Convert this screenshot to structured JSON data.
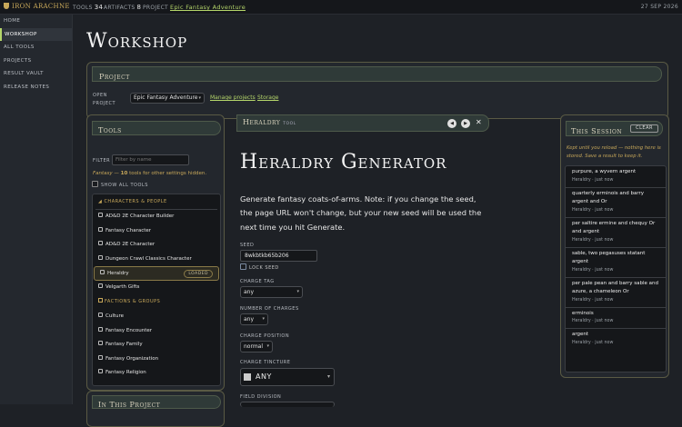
{
  "topbar": {
    "brand": "IRON ARACHNE",
    "tools_label": "TOOLS",
    "tools_count": "34",
    "artifacts_label": "ARTIFACTS",
    "artifacts_count": "8",
    "project_label": "PROJECT",
    "project_name": "Epic Fantasy Adventure",
    "date": "27 SEP 2026"
  },
  "sidebar": {
    "items": [
      {
        "label": "HOME"
      },
      {
        "label": "WORKSHOP"
      },
      {
        "label": "ALL TOOLS"
      },
      {
        "label": "PROJECTS"
      },
      {
        "label": "RESULT VAULT"
      },
      {
        "label": "RELEASE NOTES"
      }
    ],
    "active_index": 1
  },
  "page_title": "Workshop",
  "project_panel": {
    "title": "Project",
    "open_label_1": "OPEN",
    "open_label_2": "PROJECT",
    "selected": "Epic Fantasy Adventure",
    "manage_link": "Manage projects",
    "storage_link": "Storage"
  },
  "tools_panel": {
    "title": "Tools",
    "filter_label": "FILTER",
    "filter_placeholder": "Filter by name",
    "hint_genre": "Fantasy",
    "hint_count": "10",
    "hint_rest": "tools for other settings hidden.",
    "show_all_label": "SHOW ALL TOOLS",
    "groups": [
      {
        "label": "CHARACTERS & PEOPLE",
        "items": [
          "AD&D 2E Character Builder",
          "Fantasy Character",
          "AD&D 2E Character",
          "Dungeon Crawl Classics Character",
          "Heraldry",
          "Velgarth Gifts"
        ]
      },
      {
        "label": "FACTIONS & GROUPS",
        "items": [
          "Culture",
          "Fantasy Encounter",
          "Fantasy Family",
          "Fantasy Organization",
          "Fantasy Religion"
        ]
      }
    ],
    "selected_item": "Heraldry",
    "loaded_badge": "LOADED"
  },
  "in_project_panel": {
    "title": "In This Project"
  },
  "tool_view": {
    "toolbar_title": "Heraldry",
    "toolbar_sub": "TOOL",
    "heading": "Heraldry Generator",
    "description": "Generate fantasy coats-of-arms. Note: if you change the seed, the page URL won't change, but your new seed will be used the next time you hit Generate.",
    "seed_label": "SEED",
    "seed_value": "8wkbtkb65b206",
    "lock_seed_label": "LOCK SEED",
    "charge_tag_label": "CHARGE TAG",
    "charge_tag_value": "any",
    "num_charges_label": "NUMBER OF CHARGES",
    "num_charges_value": "any",
    "charge_position_label": "CHARGE POSITION",
    "charge_position_value": "normal",
    "charge_tincture_label": "CHARGE TINCTURE",
    "charge_tincture_value": "ANY",
    "field_division_label": "FIELD DIVISION"
  },
  "session_panel": {
    "title": "This Session",
    "clear_label": "CLEAR",
    "note": "Kept until you reload — nothing here is stored. Save a result to keep it.",
    "items": [
      {
        "text": "purpure, a wyvern argent",
        "meta": "Heraldry · just now"
      },
      {
        "text": "quarterly erminois and barry argent and Or",
        "meta": "Heraldry · just now"
      },
      {
        "text": "per saltire ermine and chequy Or and argent",
        "meta": "Heraldry · just now"
      },
      {
        "text": "sable, two pegasuses statant argent",
        "meta": "Heraldry · just now"
      },
      {
        "text": "per pale pean and barry sable and azure, a chameleon Or",
        "meta": "Heraldry · just now"
      },
      {
        "text": "erminois",
        "meta": "Heraldry · just now"
      },
      {
        "text": "argent",
        "meta": "Heraldry · just now"
      }
    ]
  },
  "colors": {
    "accent": "#b5d66a",
    "gold": "#c8a85a",
    "panel_border": "#5a5a44"
  }
}
